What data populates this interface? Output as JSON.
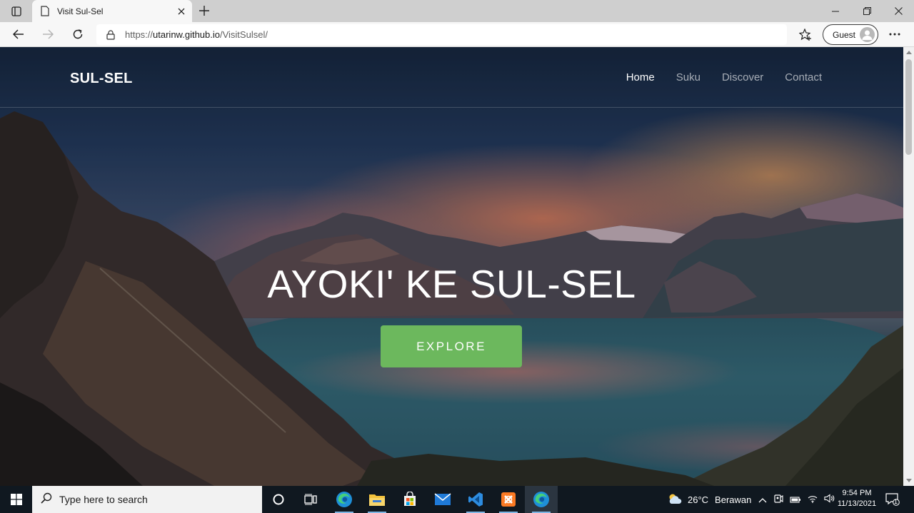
{
  "browser": {
    "tab_title": "Visit Sul-Sel",
    "url_prefix": "https://",
    "url_host": "utarinw.github.io",
    "url_path": "/VisitSulsel/",
    "profile_label": "Guest"
  },
  "site": {
    "brand": "SUL-SEL",
    "nav": [
      {
        "label": "Home",
        "active": true
      },
      {
        "label": "Suku",
        "active": false
      },
      {
        "label": "Discover",
        "active": false
      },
      {
        "label": "Contact",
        "active": false
      }
    ],
    "hero_title": "AYOKI' KE SUL-SEL",
    "explore_label": "EXPLORE",
    "accent_color": "#6cb85d"
  },
  "taskbar": {
    "search_placeholder": "Type here to search",
    "weather_temp": "26°C",
    "weather_text": "Berawan",
    "time": "9:54 PM",
    "date": "11/13/2021",
    "notification_count": "1",
    "apps": [
      "cortana-icon",
      "task-view-icon",
      "edge-icon",
      "file-explorer-icon",
      "store-icon",
      "mail-icon",
      "vscode-icon",
      "xampp-icon",
      "edge-active-icon"
    ]
  }
}
